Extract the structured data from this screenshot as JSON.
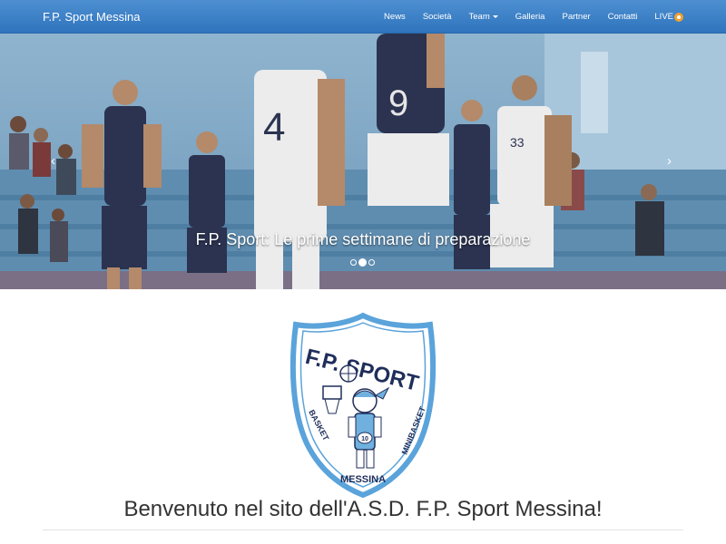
{
  "navbar": {
    "brand": "F.P. Sport Messina",
    "items": [
      {
        "label": "News"
      },
      {
        "label": "Società"
      },
      {
        "label": "Team"
      },
      {
        "label": "Galleria"
      },
      {
        "label": "Partner"
      },
      {
        "label": "Contatti"
      },
      {
        "label": "LIVE"
      }
    ]
  },
  "carousel": {
    "caption": "F.P. Sport: Le prime settimane di preparazione",
    "slide_count": 3,
    "active_index": 1
  },
  "logo": {
    "top_text": "F.P. SPORT",
    "left_text": "BASKET",
    "right_text": "MINIBASKET",
    "bottom_text": "MESSINA",
    "jersey_number": "10"
  },
  "main": {
    "welcome": "Benvenuto nel sito dell'A.S.D. F.P. Sport Messina!"
  },
  "colors": {
    "navbar": "#357bc4",
    "logo_border": "#5aa3db"
  }
}
